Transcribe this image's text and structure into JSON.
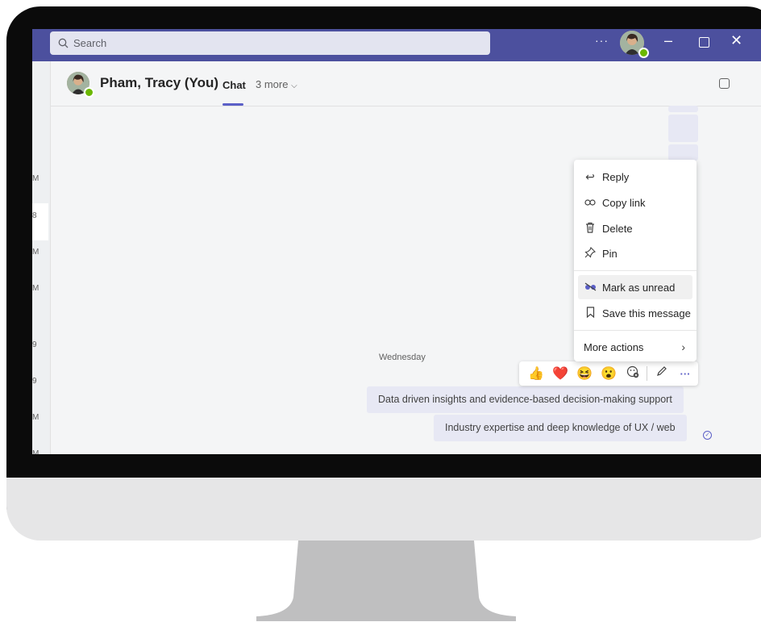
{
  "search": {
    "placeholder": "Search"
  },
  "titlebar": {
    "more": "···",
    "minimize": "–",
    "close": "✕"
  },
  "left_rail": {
    "times": [
      "M",
      "8",
      "M",
      "M",
      "9",
      "9",
      "M",
      "M"
    ]
  },
  "chat_header": {
    "name": "Pham, Tracy (You)",
    "tab_chat": "Chat",
    "tab_more": "3 more"
  },
  "conversation": {
    "date_label": "Wednesday",
    "messages": [
      "Data driven insights and evidence-based decision-making support",
      "Industry expertise and deep knowledge of UX / web"
    ]
  },
  "reactions": {
    "like": "👍",
    "heart": "❤️",
    "laugh": "😆",
    "surprised": "😮",
    "more": "···"
  },
  "context_menu": {
    "reply": "Reply",
    "copy_link": "Copy link",
    "delete": "Delete",
    "pin": "Pin",
    "mark_unread": "Mark as unread",
    "save_message": "Save this message",
    "more_actions": "More actions"
  },
  "colors": {
    "accent": "#5b5fc7",
    "titlebar": "#4c509e",
    "bubble": "#e7e8f4",
    "presence": "#6bb700"
  }
}
